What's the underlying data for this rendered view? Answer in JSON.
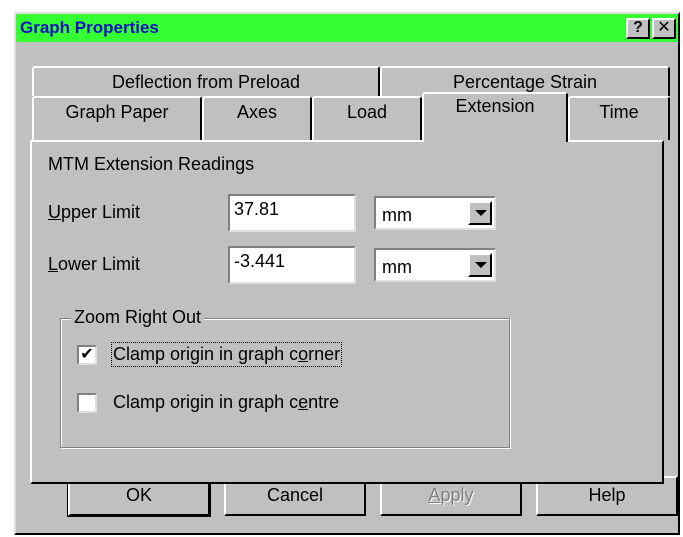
{
  "window": {
    "title": "Graph Properties",
    "help_btn": "?",
    "close_btn": "✕",
    "title_bar_color": "#33ff33",
    "title_text_color": "#1010c0"
  },
  "tabs": {
    "back_row": [
      "Deflection from Preload",
      "Percentage Strain"
    ],
    "front_row": [
      "Graph Paper",
      "Axes",
      "Load",
      "Extension",
      "Time"
    ],
    "active": "Extension"
  },
  "panel": {
    "heading": "MTM Extension Readings",
    "upper": {
      "label_u": "U",
      "label_rest": "pper Limit",
      "value": "37.81",
      "unit": "mm"
    },
    "lower": {
      "label_u": "L",
      "label_rest": "ower Limit",
      "value": "-3.441",
      "unit": "mm"
    },
    "zoom_group": {
      "title": "Zoom Right Out",
      "options": [
        {
          "pre": "Clamp origin in graph c",
          "u": "o",
          "post": "rner",
          "checked": true
        },
        {
          "pre": "Clamp origin in graph c",
          "u": "e",
          "post": "ntre",
          "checked": false
        }
      ]
    }
  },
  "buttons": {
    "ok": "OK",
    "cancel": "Cancel",
    "apply_u": "A",
    "apply_rest": "pply",
    "help": "Help"
  },
  "check_mark": "✔"
}
